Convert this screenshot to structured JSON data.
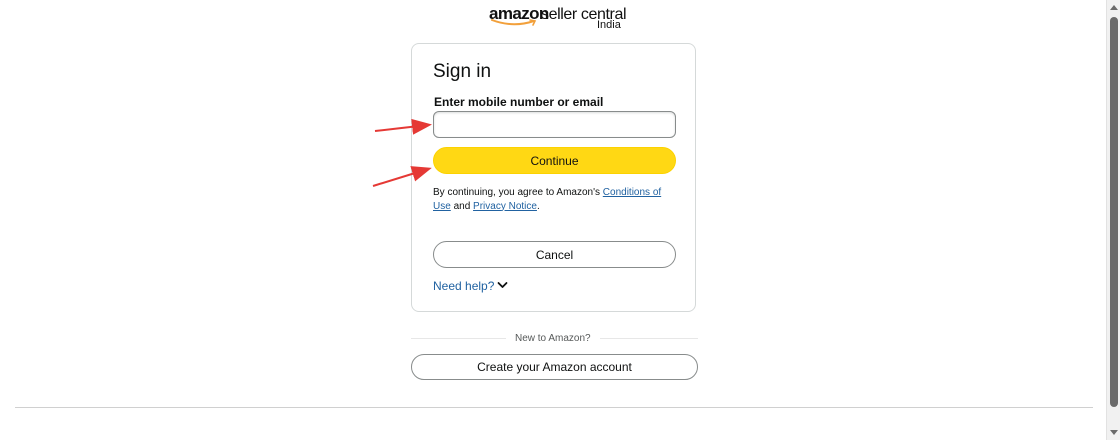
{
  "logo": {
    "brand": "amazon",
    "product": "seller central",
    "country": "India"
  },
  "signin": {
    "title": "Sign in",
    "field_label": "Enter mobile number or email",
    "input_value": "",
    "input_placeholder": "",
    "continue_label": "Continue",
    "legal": {
      "prefix": "By continuing, you agree to Amazon's ",
      "conditions_link": "Conditions of Use",
      "and": " and ",
      "privacy_link": "Privacy Notice",
      "suffix": "."
    },
    "cancel_label": "Cancel",
    "need_help_label": "Need help?"
  },
  "new_customer": {
    "divider_text": "New to Amazon?",
    "create_account_label": "Create your Amazon account"
  },
  "colors": {
    "accent_button": "#ffd814",
    "link": "#2162a1",
    "annotation_arrow": "#e53935"
  },
  "icons": {
    "need_help": "chevron-down-icon",
    "logo_smile": "amazon-smile-icon"
  }
}
